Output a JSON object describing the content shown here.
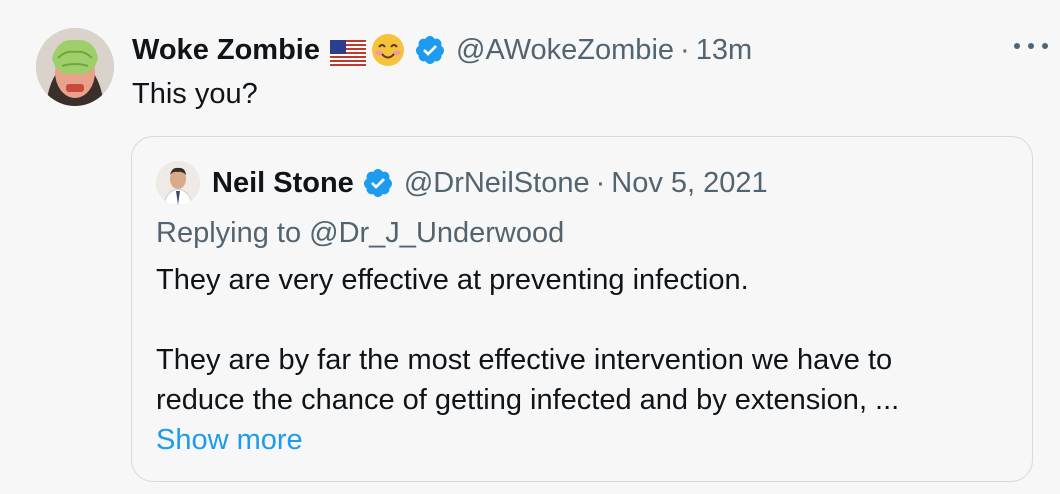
{
  "tweet": {
    "author_name": "Woke Zombie",
    "author_handle": "@AWokeZombie",
    "separator": "·",
    "time": "13m",
    "text": "This you?",
    "icons": [
      "us-flag-emoji",
      "smiling-face-emoji",
      "verified-badge-icon",
      "more-options-icon"
    ]
  },
  "quote": {
    "author_name": "Neil Stone",
    "author_handle": "@DrNeilStone",
    "separator": "·",
    "date": "Nov 5, 2021",
    "replying_to": "Replying to @Dr_J_Underwood",
    "paragraph_1": "They are very effective at preventing infection.",
    "paragraph_2_line_1": "They are by far the most effective intervention we have to",
    "paragraph_2_line_2": "reduce the chance of getting infected and by extension, ...",
    "show_more": "Show more"
  },
  "colors": {
    "background": "#f7f7f7",
    "text": "#0f1419",
    "secondary": "#536471",
    "link": "#1d9bf0",
    "verified": "#1d9bf0",
    "border": "#d5dadd"
  }
}
